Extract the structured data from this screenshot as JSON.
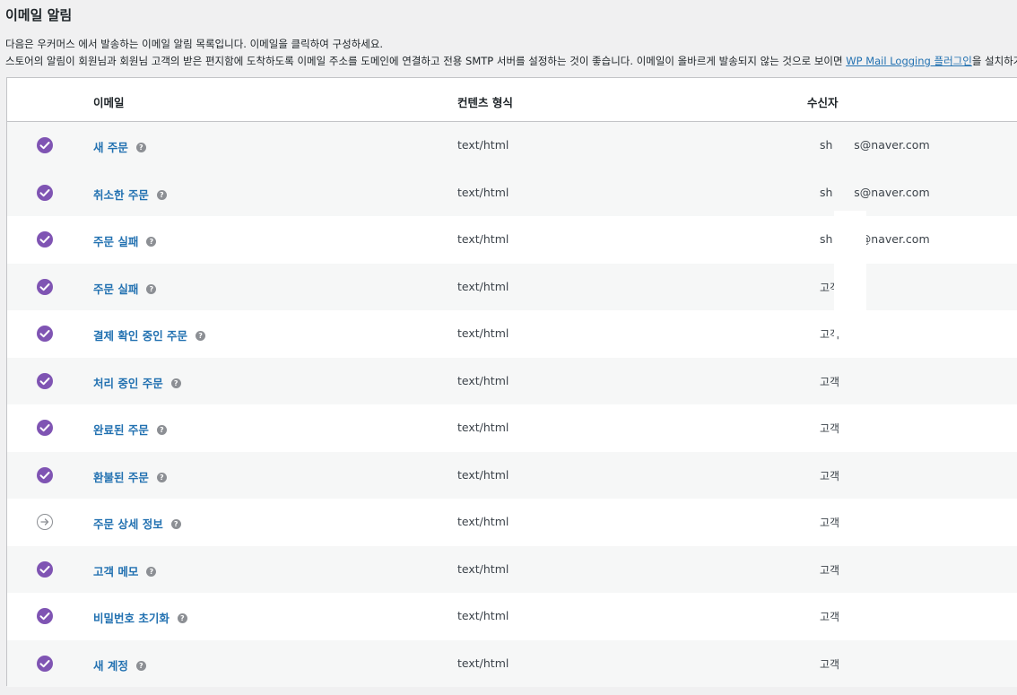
{
  "page": {
    "title": "이메일 알림",
    "desc_line1": "다음은 우커머스 에서 발송하는 이메일 알림 목록입니다. 이메일을 클릭하여 구성하세요.",
    "desc_line2_prefix": "스토어의 알림이 회원님과 회원님 고객의 받은 편지함에 도착하도록 이메일 주소를 도메인에 연결하고 전용 SMTP 서버를 설정하는 것이 좋습니다. 이메일이 올바르게 발송되지 않는 것으로 보이면 ",
    "desc_link": "WP Mail Logging 플러그인",
    "desc_line2_suffix": "을 설치하거나"
  },
  "table": {
    "headers": {
      "email": "이메일",
      "content_type": "컨텐츠 형식",
      "recipient": "수신자"
    },
    "rows": [
      {
        "name": "새 주문",
        "content_type": "text/html",
        "recipient": "sh      s@naver.com",
        "enabled": true
      },
      {
        "name": "취소한 주문",
        "content_type": "text/html",
        "recipient": "sh      s@naver.com",
        "enabled": true
      },
      {
        "name": "주문 실패",
        "content_type": "text/html",
        "recipient": "sh      s@naver.com",
        "enabled": true
      },
      {
        "name": "주문 실패",
        "content_type": "text/html",
        "recipient": "고객",
        "enabled": true
      },
      {
        "name": "결제 확인 중인 주문",
        "content_type": "text/html",
        "recipient": "고객",
        "enabled": true
      },
      {
        "name": "처리 중인 주문",
        "content_type": "text/html",
        "recipient": "고객",
        "enabled": true
      },
      {
        "name": "완료된 주문",
        "content_type": "text/html",
        "recipient": "고객",
        "enabled": true
      },
      {
        "name": "환불된 주문",
        "content_type": "text/html",
        "recipient": "고객",
        "enabled": true
      },
      {
        "name": "주문 상세 정보",
        "content_type": "text/html",
        "recipient": "고객",
        "enabled": false
      },
      {
        "name": "고객 메모",
        "content_type": "text/html",
        "recipient": "고객",
        "enabled": true
      },
      {
        "name": "비밀번호 초기화",
        "content_type": "text/html",
        "recipient": "고객",
        "enabled": true
      },
      {
        "name": "새 계정",
        "content_type": "text/html",
        "recipient": "고객",
        "enabled": true
      }
    ]
  },
  "icons": {
    "enabled": "check-circle-icon",
    "manual": "arrow-circle-icon",
    "help": "help-icon"
  },
  "colors": {
    "enabled": "#7f54b3",
    "link": "#2271b1",
    "manual": "#8c8f94"
  }
}
